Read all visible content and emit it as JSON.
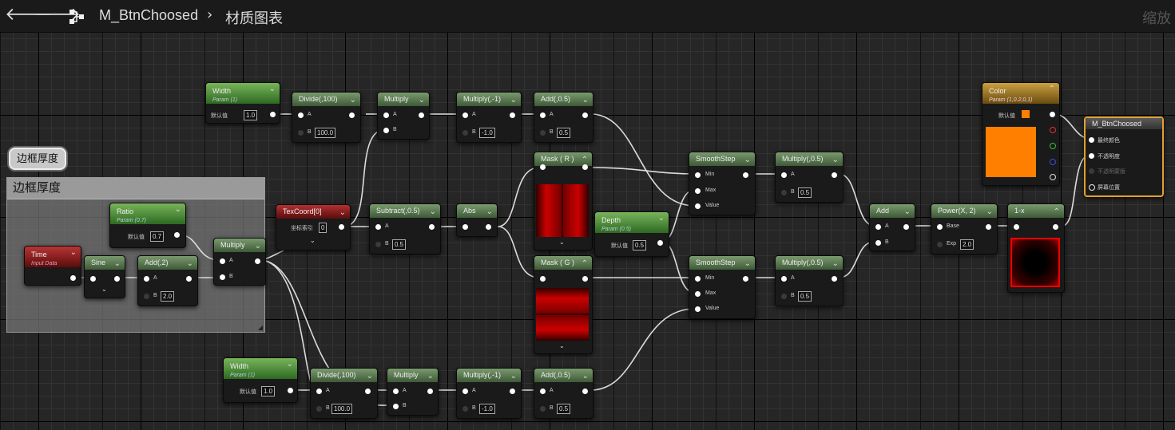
{
  "toolbar": {
    "back_icon": "arrow-left-icon",
    "forward_icon": "arrow-right-icon",
    "graph_icon": "material-graph-icon",
    "asset_name": "M_BtnChoosed",
    "separator": "›",
    "graph_name": "材质图表",
    "zoom_label": "缩放"
  },
  "comment": {
    "title": "边框厚度",
    "bubble": "边框厚度"
  },
  "labels": {
    "default_value": "默认值",
    "coord_index": "坐标索引",
    "A": "A",
    "B": "B",
    "min": "Min",
    "max": "Max",
    "value": "Value",
    "base": "Base",
    "exp": "Exp"
  },
  "nodes": {
    "width_top": {
      "title": "Width",
      "subtitle": "Param (1)",
      "value": "1.0"
    },
    "divide_top": {
      "title": "Divide(,100)",
      "b": "100.0"
    },
    "multiply_top": {
      "title": "Multiply"
    },
    "multiply_neg_top": {
      "title": "Multiply(,-1)",
      "b": "-1.0"
    },
    "add_top": {
      "title": "Add(,0.5)",
      "b": "0.5"
    },
    "ratio": {
      "title": "Ratio",
      "subtitle": "Param (0.7)",
      "value": "0.7"
    },
    "time": {
      "title": "Time",
      "subtitle": "Input Data"
    },
    "sine": {
      "title": "Sine"
    },
    "add2": {
      "title": "Add(,2)",
      "b": "2.0"
    },
    "multiply_mid": {
      "title": "Multiply"
    },
    "texcoord": {
      "title": "TexCoord[0]",
      "value": "0"
    },
    "subtract": {
      "title": "Subtract(,0.5)",
      "b": "0.5"
    },
    "abs": {
      "title": "Abs"
    },
    "mask_r": {
      "title": "Mask ( R )"
    },
    "mask_g": {
      "title": "Mask ( G )"
    },
    "depth": {
      "title": "Depth",
      "subtitle": "Param (0.5)",
      "value": "0.5"
    },
    "smooth_top": {
      "title": "SmoothStep"
    },
    "smooth_bot": {
      "title": "SmoothStep"
    },
    "mult05_top": {
      "title": "Multiply(,0.5)",
      "b": "0.5"
    },
    "mult05_bot": {
      "title": "Multiply(,0.5)",
      "b": "0.5"
    },
    "add_mid": {
      "title": "Add"
    },
    "power": {
      "title": "Power(X, 2)",
      "exp": "2.0"
    },
    "one_minus": {
      "title": "1-x"
    },
    "color": {
      "title": "Color",
      "subtitle": "Param (1,0.2,0,1)"
    },
    "output": {
      "title": "M_BtnChoosed",
      "pins": [
        "最终颜色",
        "不透明度",
        "不透明蒙版",
        "屏幕位置"
      ]
    },
    "width_bot": {
      "title": "Width",
      "subtitle": "Param (1)",
      "value": "1.0"
    },
    "divide_bot": {
      "title": "Divide(,100)",
      "b": "100.0"
    },
    "multiply_bot": {
      "title": "Multiply"
    },
    "multiply_neg_bot": {
      "title": "Multiply(,-1)",
      "b": "-1.0"
    },
    "add_bot": {
      "title": "Add(,0.5)",
      "b": "0.5"
    }
  },
  "colors": {
    "swatch": "#ff8000",
    "pin_red": "#e03030",
    "pin_green": "#30c030",
    "pin_blue": "#3050e0"
  }
}
